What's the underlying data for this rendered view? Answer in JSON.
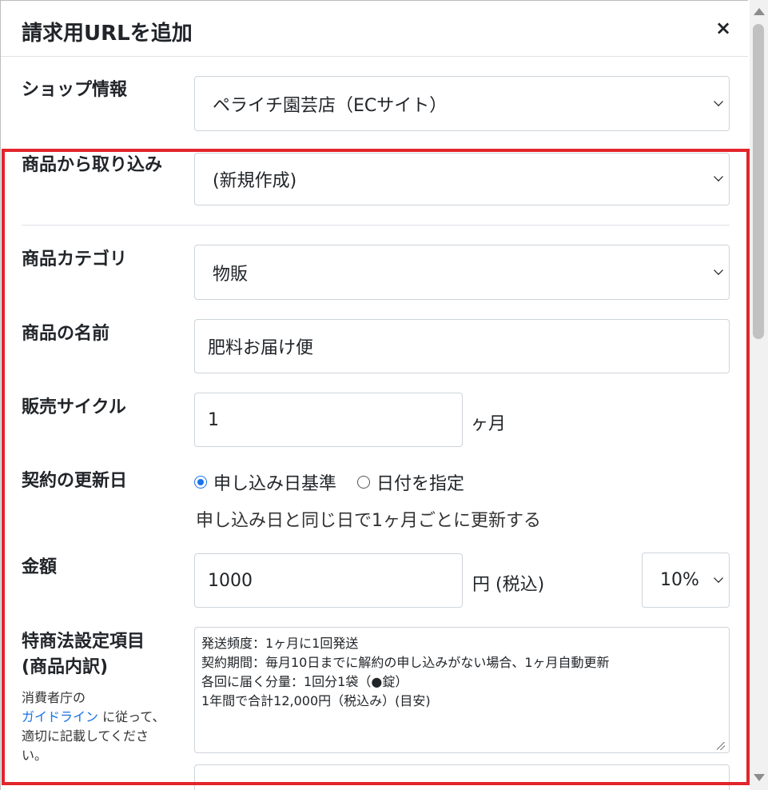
{
  "dialog": {
    "title": "請求用URLを追加",
    "close": "×"
  },
  "shop": {
    "label": "ショップ情報",
    "value": "ペライチ園芸店（ECサイト）"
  },
  "import": {
    "label": "商品から取り込み",
    "value": "(新規作成)"
  },
  "category": {
    "label": "商品カテゴリ",
    "value": "物販"
  },
  "name": {
    "label": "商品の名前",
    "value": "肥料お届け便"
  },
  "cycle": {
    "label": "販売サイクル",
    "value": "1",
    "unit": "ヶ月"
  },
  "renewal": {
    "label": "契約の更新日",
    "options": [
      "申し込み日基準",
      "日付を指定"
    ],
    "selected_index": 0,
    "help": "申し込み日と同じ日で1ヶ月ごとに更新する"
  },
  "price": {
    "label": "金額",
    "value": "1000",
    "unit": "円 (税込)",
    "tax": "10%"
  },
  "legal": {
    "label_line1": "特商法設定項目",
    "label_line2": "(商品内訳)",
    "note_before": "消費者庁の",
    "note_link": "ガイドライン",
    "note_after": " に従って、適切に記載してください。",
    "text": "発送頻度：1ヶ月に1回発送\n契約期間：毎月10日までに解約の申し込みがない場合、1ヶ月自動更新\n各回に届く分量：1回分1袋（●錠）\n1年間で合計12,000円（税込み）(目安)"
  },
  "colors": {
    "highlight": "#e3242b",
    "link": "#1a73e8"
  }
}
